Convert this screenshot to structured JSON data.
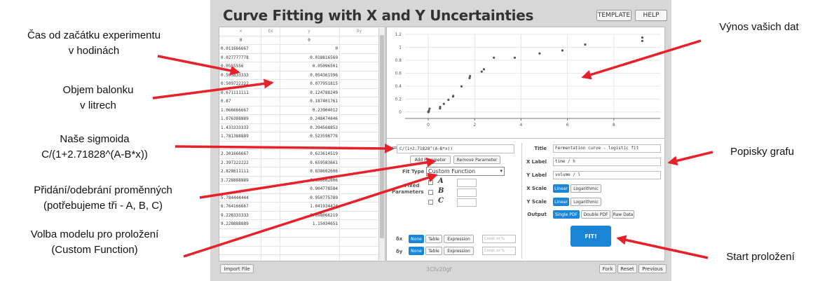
{
  "app": {
    "title": "Curve Fitting with X and Y Uncertainties",
    "template_label": "TEMPLATE",
    "help_label": "HELP"
  },
  "table": {
    "headers": [
      "x",
      "δx",
      "y",
      "δy"
    ],
    "rows": [
      [
        "0",
        "",
        "0",
        ""
      ],
      [
        "0.011666667",
        "",
        "0",
        ""
      ],
      [
        "0.027777778",
        "",
        "0.018816569",
        ""
      ],
      [
        "0.0555556",
        "",
        "0.05096501",
        ""
      ],
      [
        "0.505833333",
        "",
        "0.054361596",
        ""
      ],
      [
        "0.509722222",
        "",
        "0.077951815",
        ""
      ],
      [
        "0.671111111",
        "",
        "0.124788249",
        ""
      ],
      [
        "0.87",
        "",
        "0.187401761",
        ""
      ],
      [
        "1.066666667",
        "",
        "0.23904012",
        ""
      ],
      [
        "1.076388889",
        "",
        "0.248474846",
        ""
      ],
      [
        "1.433333333",
        "",
        "0.394568853",
        ""
      ],
      [
        "1.781388889",
        "",
        "0.523598776",
        ""
      ],
      [
        "",
        "",
        "",
        ""
      ],
      [
        "2.301666667",
        "",
        "0.623614519",
        ""
      ],
      [
        "2.397222222",
        "",
        "0.659583661",
        ""
      ],
      [
        "2.828611111",
        "",
        "0.838602606",
        ""
      ],
      [
        "3.728888889",
        "",
        "0.838602606",
        ""
      ],
      [
        "",
        "",
        "0.904778584",
        ""
      ],
      [
        "5.784444444",
        "",
        "0.950775789",
        ""
      ],
      [
        "6.764166667",
        "",
        "1.041934424",
        ""
      ],
      [
        "9.228333333",
        "",
        "1.098066219",
        ""
      ],
      [
        "9.228888889",
        "",
        "1.15034651",
        ""
      ],
      [
        "",
        "",
        "",
        ""
      ],
      [
        "",
        "",
        "",
        ""
      ],
      [
        "",
        "",
        "",
        ""
      ],
      [
        "",
        "",
        "",
        ""
      ]
    ]
  },
  "chart_data": {
    "type": "scatter",
    "xlim": [
      -1,
      10
    ],
    "ylim": [
      -0.1,
      1.2
    ],
    "xticks": [
      "0",
      "2",
      "4",
      "6",
      "8"
    ],
    "yticks": [
      "0",
      "0.2",
      "0.4",
      "0.6",
      "0.8",
      "1",
      "1.2"
    ],
    "grid": true,
    "points": [
      [
        0,
        0
      ],
      [
        0.0117,
        0
      ],
      [
        0.028,
        0.019
      ],
      [
        0.0556,
        0.051
      ],
      [
        0.506,
        0.054
      ],
      [
        0.51,
        0.078
      ],
      [
        0.671,
        0.125
      ],
      [
        0.87,
        0.187
      ],
      [
        1.067,
        0.239
      ],
      [
        1.076,
        0.248
      ],
      [
        1.433,
        0.395
      ],
      [
        1.781,
        0.524
      ],
      [
        1.8,
        0.555
      ],
      [
        2.302,
        0.624
      ],
      [
        2.397,
        0.66
      ],
      [
        2.829,
        0.839
      ],
      [
        3.729,
        0.839
      ],
      [
        4.8,
        0.905
      ],
      [
        5.784,
        0.951
      ],
      [
        6.764,
        1.042
      ],
      [
        9.228,
        1.098
      ],
      [
        9.229,
        1.15
      ]
    ]
  },
  "fit_panel": {
    "formula_prefix": "y=",
    "formula": "C/(1+2.71828^(A-B*x))",
    "add_parameter": "Add Parameter",
    "remove_parameter": "Remove Parameter",
    "fit_type_label": "Fit Type",
    "fit_type_value": "Custom Function",
    "fixed_label_1": "Fixed",
    "fixed_label_2": "Parameters",
    "params": [
      "A",
      "B",
      "C"
    ],
    "dx_label": "δx",
    "dy_label": "δy",
    "unc_none": "None",
    "unc_table": "Table",
    "unc_expression": "Expression",
    "const_placeholder": "Const. or %"
  },
  "plot_settings": {
    "title_label": "Title",
    "title_value": "Fermentation curve - logistic fit",
    "xlabel_label": "X Label",
    "xlabel_value": "time / h",
    "ylabel_label": "Y Label",
    "ylabel_value": "volume / l",
    "xscale_label": "X Scale",
    "yscale_label": "Y Scale",
    "linear": "Linear",
    "log": "Logarithmic",
    "output_label": "Output",
    "single_pdf": "Single PDF",
    "double_pdf": "Double PDF",
    "raw_data": "Raw Data",
    "fit_button": "FIT!"
  },
  "footer": {
    "import_file": "Import File",
    "code": "3Cfv20gf",
    "fork": "Fork",
    "reset": "Reset",
    "previous": "Previous"
  },
  "annotations": {
    "time_line1": "Čas od začátku experimentu",
    "time_line2": "v hodinách",
    "volume_line1": "Objem balonku",
    "volume_line2": "v litrech",
    "sigmoid_line1": "Naše sigmoida",
    "sigmoid_line2": "C/(1+2.71828^(A-B*x))",
    "params_line1": "Přidání/odebrání proměnných",
    "params_line2": "(potřebujeme tři - A, B, C)",
    "model_line1": "Volba modelu pro proložení",
    "model_line2": "(Custom Function)",
    "plot_text": "Výnos vašich dat",
    "labels_text": "Popisky grafu",
    "start_text": "Start proložení"
  },
  "colors": {
    "accent": "#1b86d8",
    "arrow": "#e8202a"
  }
}
